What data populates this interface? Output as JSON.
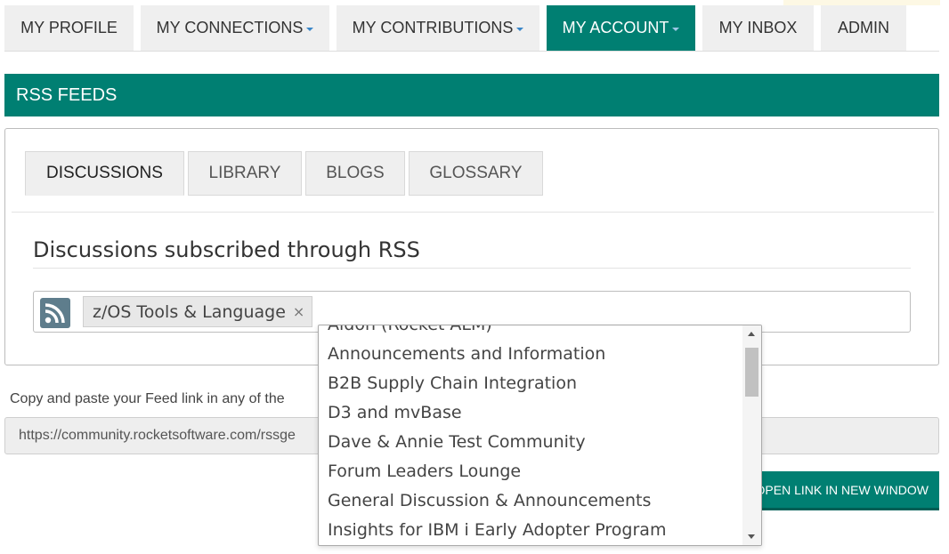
{
  "nav": {
    "tabs": [
      {
        "label": "MY PROFILE",
        "dropdown": false,
        "active": false
      },
      {
        "label": "MY CONNECTIONS",
        "dropdown": true,
        "active": false
      },
      {
        "label": "MY CONTRIBUTIONS",
        "dropdown": true,
        "active": false
      },
      {
        "label": "MY ACCOUNT",
        "dropdown": true,
        "active": true
      },
      {
        "label": "MY INBOX",
        "dropdown": false,
        "active": false
      },
      {
        "label": "ADMIN",
        "dropdown": false,
        "active": false
      }
    ]
  },
  "section": {
    "title": "RSS FEEDS"
  },
  "feed_tabs": [
    "DISCUSSIONS",
    "LIBRARY",
    "BLOGS",
    "GLOSSARY"
  ],
  "panel": {
    "heading": "Discussions subscribed through RSS",
    "selected_tag": "z/OS Tools & Language",
    "remove_symbol": "×"
  },
  "dropdown": {
    "options": [
      "Aldon (Rocket ALM)",
      "Announcements and Information",
      "B2B Supply Chain Integration",
      "D3 and mvBase",
      "Dave & Annie Test Community",
      "Forum Leaders Lounge",
      "General Discussion & Announcements",
      "Insights for IBM i Early Adopter Program"
    ]
  },
  "feed_link": {
    "instruction": "Copy and paste your Feed link in any of the",
    "url": "https://community.rocketsoftware.com/rssge",
    "open_button": "OPEN LINK IN NEW WINDOW"
  },
  "colors": {
    "brand": "#007f72",
    "tab_bg": "#efefef",
    "dropdown_caret": "#3a86c8"
  },
  "icons": {
    "rss": "rss-icon",
    "remove": "close-icon",
    "caret": "caret-down-icon"
  }
}
